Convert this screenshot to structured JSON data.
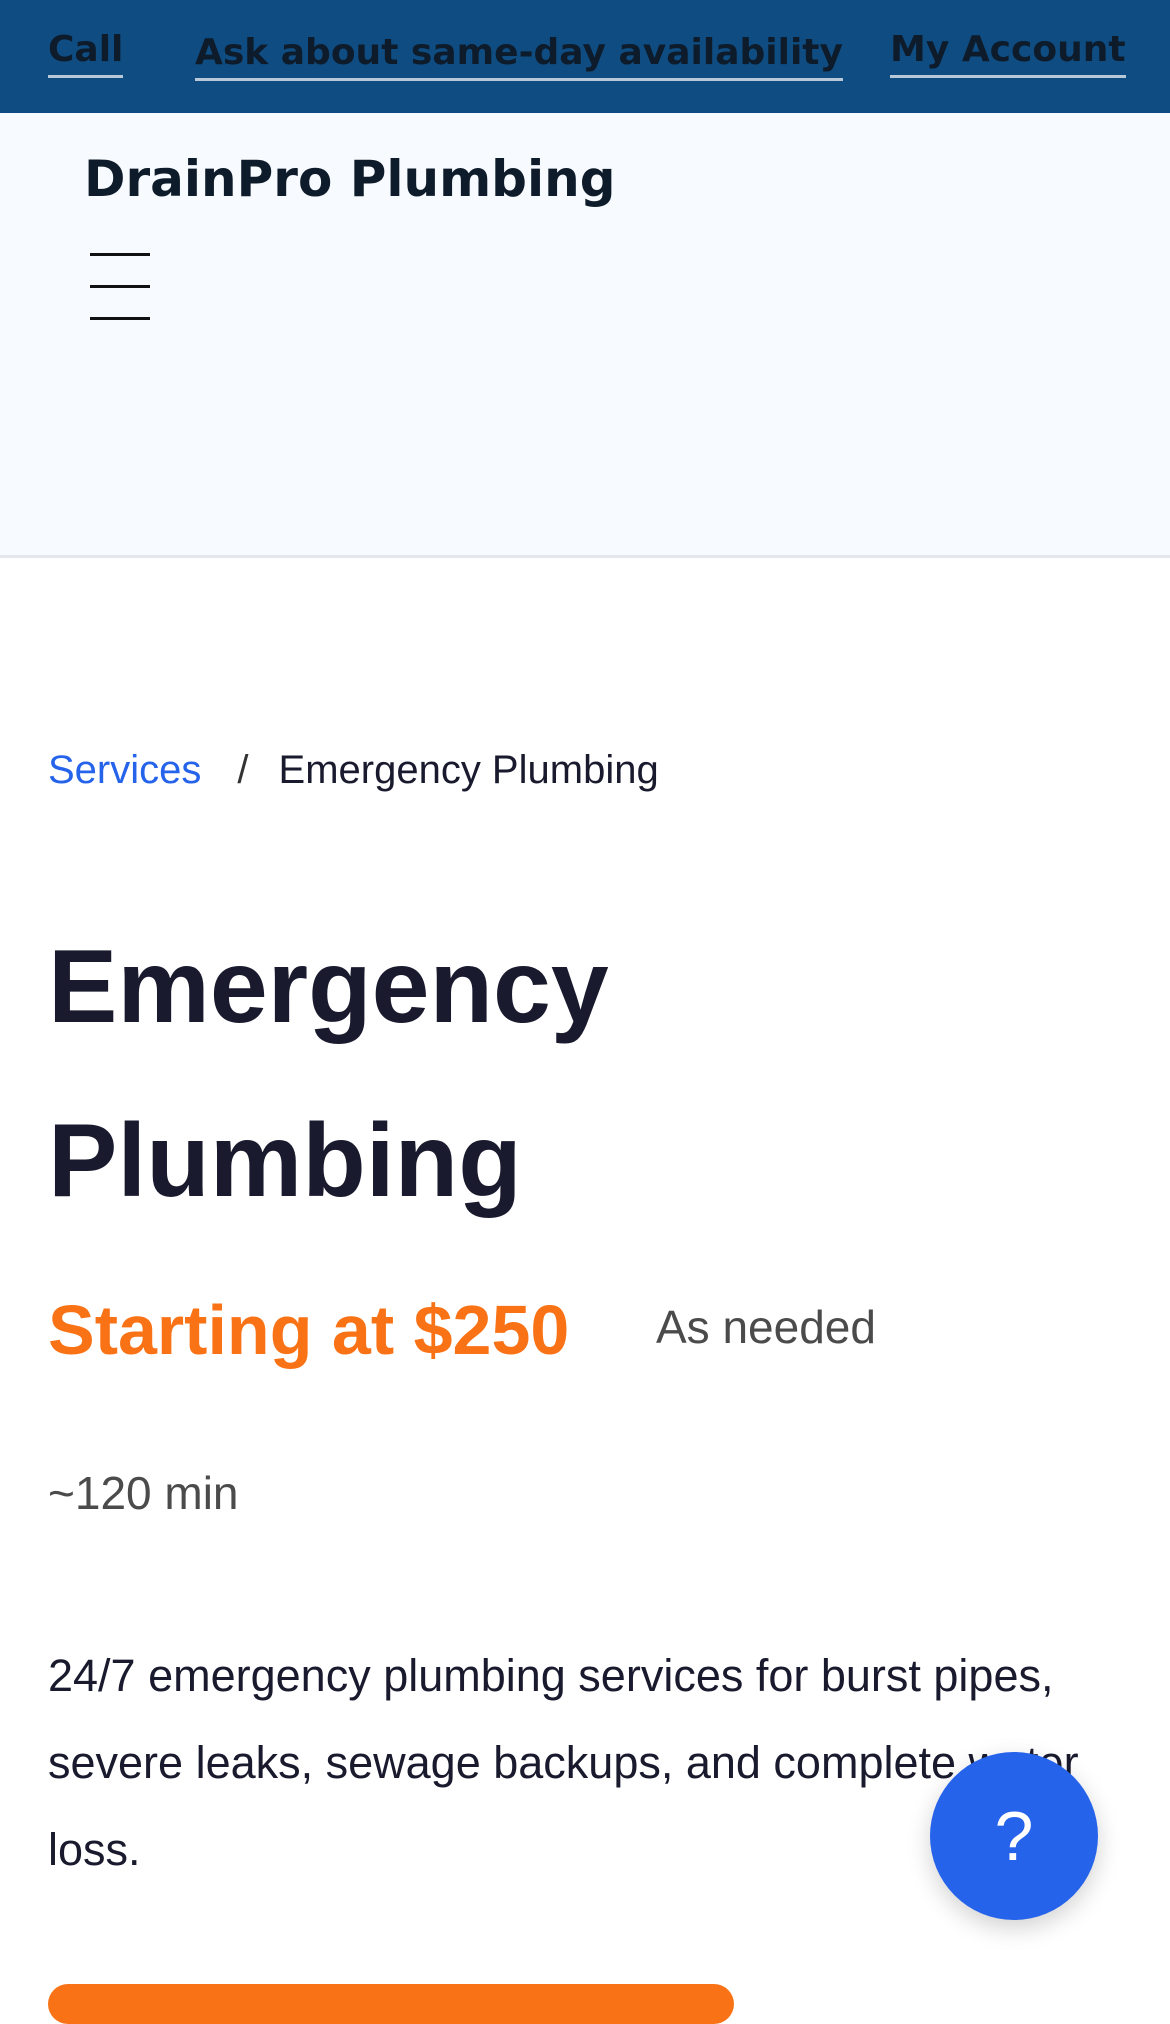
{
  "topbar": {
    "call_label": "Call",
    "same_day_label": "Ask about same-day availability",
    "account_label": "My Account"
  },
  "header": {
    "brand": "DrainPro Plumbing",
    "menu_icon": "hamburger-menu-icon"
  },
  "breadcrumb": {
    "parent_label": "Services",
    "separator": "/",
    "current_label": "Emergency Plumbing"
  },
  "service": {
    "title": "Emergency Plumbing",
    "price": "Starting at $250",
    "frequency": "As needed",
    "duration": "~120 min",
    "description": "24/7 emergency plumbing services for burst pipes, severe leaks, sewage backups, and complete water loss."
  },
  "help_button": {
    "label": "?"
  },
  "colors": {
    "topbar_bg": "#0f4c81",
    "header_bg": "#f7fafe",
    "link": "#2563eb",
    "accent_orange": "#f97316",
    "fab_bg": "#2563eb"
  }
}
